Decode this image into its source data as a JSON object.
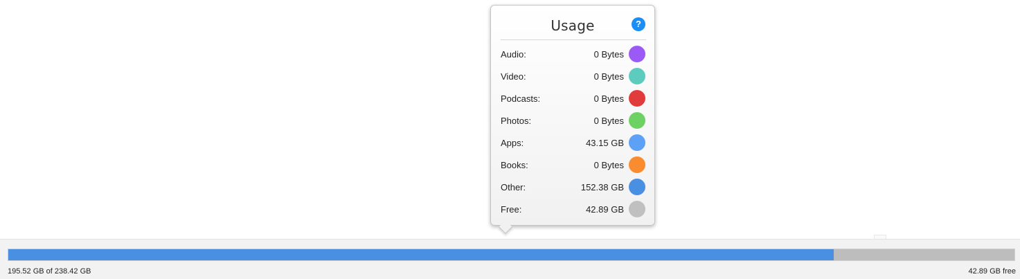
{
  "usage_popover": {
    "title": "Usage",
    "help_label": "?",
    "items": [
      {
        "label": "Audio:",
        "value": "0 Bytes",
        "color": "#9b59f5"
      },
      {
        "label": "Video:",
        "value": "0 Bytes",
        "color": "#5ecbbf"
      },
      {
        "label": "Podcasts:",
        "value": "0 Bytes",
        "color": "#e23b3b"
      },
      {
        "label": "Photos:",
        "value": "0 Bytes",
        "color": "#6dd163"
      },
      {
        "label": "Apps:",
        "value": "43.15 GB",
        "color": "#5da1f6"
      },
      {
        "label": "Books:",
        "value": "0 Bytes",
        "color": "#f98c2f"
      },
      {
        "label": "Other:",
        "value": "152.38 GB",
        "color": "#4a90e2"
      },
      {
        "label": "Free:",
        "value": "42.89 GB",
        "color": "#c0c0c0"
      }
    ]
  },
  "storage": {
    "used_text": "195.52 GB of 238.42 GB",
    "free_text": "42.89 GB free",
    "used_fraction": 0.8201,
    "used_color": "#4a90e2",
    "free_color": "#bdbdbd"
  }
}
